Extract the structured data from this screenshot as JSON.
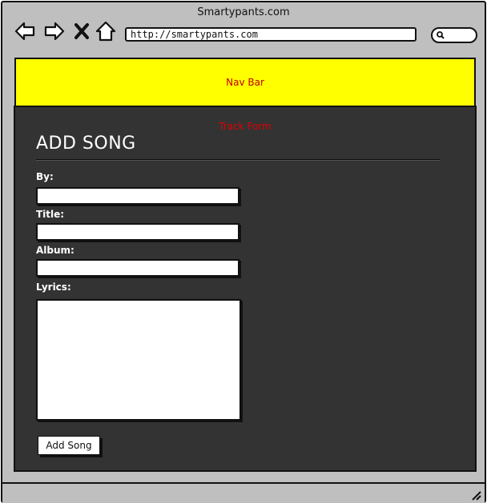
{
  "window": {
    "title": "Smartypants.com"
  },
  "toolbar": {
    "url": "http://smartypants.com",
    "icons": [
      "back-arrow-icon",
      "forward-arrow-icon",
      "close-x-icon",
      "home-icon",
      "search-icon"
    ]
  },
  "navbar": {
    "label": "Nav Bar",
    "color": "#ffff00"
  },
  "main": {
    "section_label": "Track Form",
    "title": "ADD SONG",
    "fields": [
      {
        "label": "By:",
        "value": ""
      },
      {
        "label": "Title:",
        "value": ""
      },
      {
        "label": "Album:",
        "value": ""
      },
      {
        "label": "Lyrics:",
        "value": ""
      }
    ],
    "submit_label": "Add Song"
  },
  "colors": {
    "background": "#333333",
    "annotation": "#e00000",
    "chrome": "#bfbfbf"
  }
}
